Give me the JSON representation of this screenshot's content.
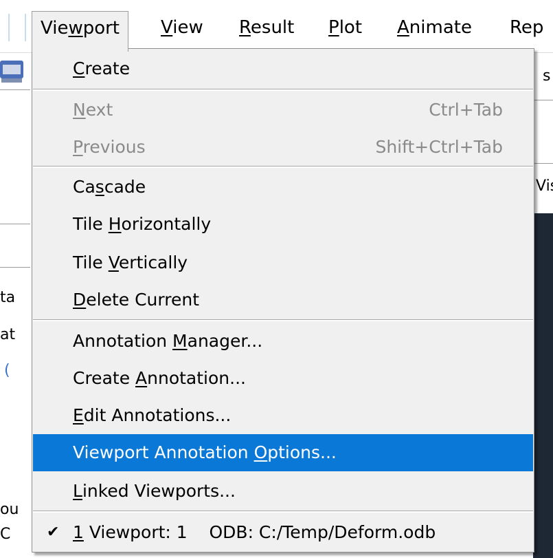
{
  "menubar": {
    "items": [
      {
        "label_pre": "Vie",
        "mnemonic": "w",
        "label_post": "port"
      },
      {
        "label_pre": "",
        "mnemonic": "V",
        "label_post": "iew"
      },
      {
        "label_pre": "",
        "mnemonic": "R",
        "label_post": "esult"
      },
      {
        "label_pre": "",
        "mnemonic": "P",
        "label_post": "lot"
      },
      {
        "label_pre": "",
        "mnemonic": "A",
        "label_post": "nimate"
      },
      {
        "label_pre": "Rep",
        "mnemonic": "",
        "label_post": ""
      }
    ]
  },
  "background": {
    "frag_sr": "s",
    "frag_vis": "Vis",
    "frag_ta": "ta",
    "frag_at": "at",
    "frag_paren": "(",
    "frag_ou": "ou",
    "frag_c": "C"
  },
  "menu": {
    "create": {
      "pre": "",
      "mn": "C",
      "post": "reate"
    },
    "next": {
      "pre": "",
      "mn": "N",
      "post": "ext",
      "shortcut": "Ctrl+Tab"
    },
    "previous": {
      "pre": "",
      "mn": "P",
      "post": "revious",
      "shortcut": "Shift+Ctrl+Tab"
    },
    "cascade": {
      "pre": "Ca",
      "mn": "s",
      "post": "cade"
    },
    "tile_h": {
      "pre": "Tile ",
      "mn": "H",
      "post": "orizontally"
    },
    "tile_v": {
      "pre": "Tile ",
      "mn": "V",
      "post": "ertically"
    },
    "delete": {
      "pre": "",
      "mn": "D",
      "post": "elete Current"
    },
    "ann_mgr": {
      "pre": "Annotation ",
      "mn": "M",
      "post": "anager..."
    },
    "create_ann": {
      "pre": "Create ",
      "mn": "A",
      "post": "nnotation..."
    },
    "edit_ann": {
      "pre": "",
      "mn": "E",
      "post": "dit Annotations..."
    },
    "vp_ann_opts": {
      "pre": "Viewport Annotation ",
      "mn": "O",
      "post": "ptions..."
    },
    "linked": {
      "pre": "",
      "mn": "L",
      "post": "inked Viewports..."
    },
    "vp1": {
      "check": "✔",
      "mn": "1",
      "post": " Viewport: 1    ODB: C:/Temp/Deform.odb"
    }
  },
  "colors": {
    "highlight": "#0a78d7",
    "menu_bg": "#f0f0f0",
    "disabled_text": "#8a8a8a",
    "dark_panel": "#1e2734"
  }
}
